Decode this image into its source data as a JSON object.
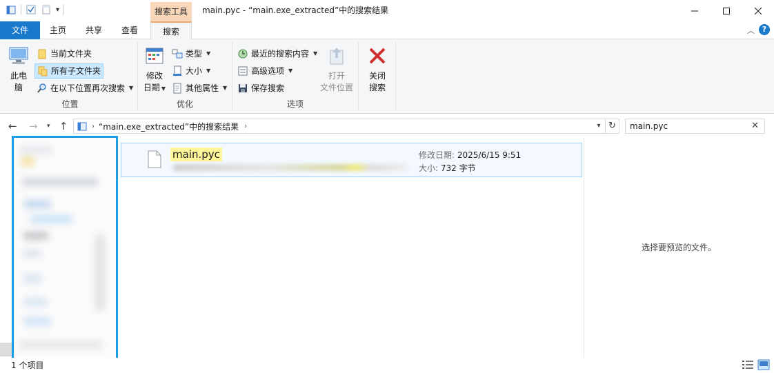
{
  "window": {
    "title": "main.pyc - “main.exe_extracted”中的搜索结果",
    "context_tab_group": "搜索工具",
    "minimize": "—",
    "maximize": "☐",
    "close": "✕"
  },
  "tabs": {
    "file": "文件",
    "home": "主页",
    "share": "共享",
    "view": "查看",
    "search": "搜索"
  },
  "ribbon": {
    "location": {
      "label": "位置",
      "this_pc_line1": "此电",
      "this_pc_line2": "脑",
      "current_folder": "当前文件夹",
      "all_subfolders": "所有子文件夹",
      "search_again": "在以下位置再次搜索"
    },
    "refine": {
      "label": "优化",
      "date_modified_line1": "修改",
      "date_modified_line2": "日期",
      "kind": "类型",
      "size": "大小",
      "other_props": "其他属性"
    },
    "options": {
      "label": "选项",
      "recent_searches": "最近的搜索内容",
      "advanced_options": "高级选项",
      "save_search": "保存搜索",
      "open_location_line1": "打开",
      "open_location_line2": "文件位置"
    },
    "close_search_line1": "关闭",
    "close_search_line2": "搜索"
  },
  "address": {
    "path": "“main.exe_extracted”中的搜索结果",
    "search_value": "main.pyc"
  },
  "result": {
    "name": "main.pyc",
    "date_label": "修改日期:",
    "date_value": "2025/6/15 9:51",
    "size_label": "大小:",
    "size_value": "732 字节"
  },
  "preview": {
    "message": "选择要预览的文件。"
  },
  "status": {
    "count": "1 个项目"
  },
  "colors": {
    "accent": "#1979ca",
    "context_tab": "#f8d6b8",
    "selection": "#cce8ff",
    "highlight": "#fff59a",
    "nav_border": "#1a9de6"
  }
}
